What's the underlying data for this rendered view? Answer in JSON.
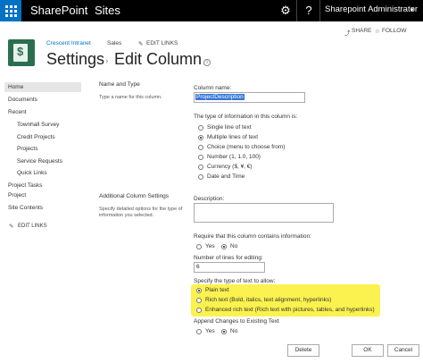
{
  "suitebar": {
    "brand": "SharePoint",
    "sites": "Sites",
    "gear": "⚙",
    "help": "?",
    "user": "Sharepoint Administrator",
    "user_caret": "▾"
  },
  "actions": {
    "share": "SHARE",
    "follow": "FOLLOW",
    "share_icon": "⤴",
    "follow_icon": "☆"
  },
  "breadcrumb": {
    "site": "Crescent Intranet",
    "sales": "Sales",
    "edit_links": "EDIT LINKS",
    "edit_icon": "✎"
  },
  "page": {
    "title": "Settings",
    "separator": "›",
    "subtitle": "Edit Column",
    "info": "i"
  },
  "nav": {
    "home": "Home",
    "documents": "Documents",
    "recent": "Recent",
    "townhall": "Townhall Survey",
    "credit": "Credit Projects",
    "projects": "Projects",
    "service": "Service Requests",
    "quick": "Quick Links",
    "project_tasks": "Project Tasks",
    "project": "Project",
    "site_contents": "Site Contents",
    "edit_links": "EDIT LINKS",
    "edit_icon": "✎"
  },
  "form": {
    "name_type_heading": "Name and Type",
    "name_type_desc": "Type a name for this column.",
    "column_name_label": "Column name:",
    "column_name_value": "ProjectDescription",
    "type_label": "The type of information in this column is:",
    "types": [
      {
        "label": "Single line of text",
        "selected": false
      },
      {
        "label": "Multiple lines of text",
        "selected": true
      },
      {
        "label": "Choice (menu to choose from)",
        "selected": false
      },
      {
        "label": "Number (1, 1.0, 100)",
        "selected": false
      },
      {
        "label": "Currency ($, ¥, €)",
        "selected": false
      },
      {
        "label": "Date and Time",
        "selected": false
      }
    ],
    "additional_heading": "Additional Column Settings",
    "additional_desc_1": "Specify detailed options for the type of",
    "additional_desc_2": "information you selected.",
    "description_label": "Description:",
    "require_label": "Require that this column contains information:",
    "yes": "Yes",
    "no": "No",
    "lines_label": "Number of lines for editing:",
    "lines_value": "6",
    "text_type_label": "Specify the type of text to allow:",
    "text_types": [
      {
        "label": "Plain text",
        "selected": true
      },
      {
        "label": "Rich text (Bold, italics, text alignment, hyperlinks)",
        "selected": false
      },
      {
        "label": "Enhanced rich text (Rich text with pictures, tables, and hyperlinks)",
        "selected": false
      }
    ],
    "append_label": "Append Changes to Existing Text"
  },
  "buttons": {
    "delete": "Delete",
    "ok": "OK",
    "cancel": "Cancel"
  },
  "colors": {
    "suitebar": "#000000",
    "waffle": "#0072c6",
    "highlight": "#fbf24f",
    "link": "#0072c6"
  }
}
